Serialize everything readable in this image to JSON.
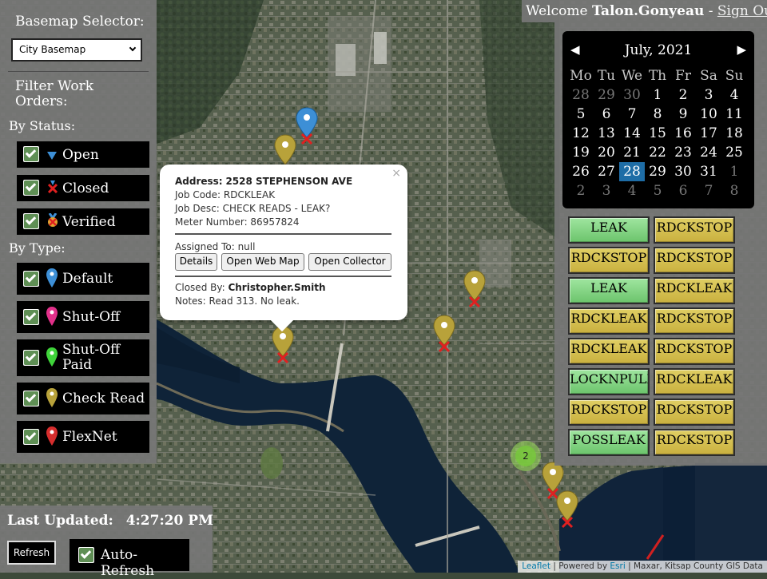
{
  "header": {
    "welcome_prefix": "Welcome",
    "username": "Talon.Gonyeau",
    "separator": "-",
    "signout_label": "Sign Out"
  },
  "left_panel": {
    "basemap_title": "Basemap Selector:",
    "basemap_selected": "City Basemap",
    "filter_title": "Filter Work Orders:",
    "by_status_label": "By Status:",
    "status_items": [
      {
        "label": "Open",
        "checked": true,
        "icon": "blue-triangle-icon"
      },
      {
        "label": "Closed",
        "checked": true,
        "icon": "red-x-icon"
      },
      {
        "label": "Verified",
        "checked": true,
        "icon": "verified-medal-icon"
      }
    ],
    "by_type_label": "By Type:",
    "type_items": [
      {
        "label": "Default",
        "checked": true,
        "icon": "blue-pin-icon",
        "color": "#3d8fd6"
      },
      {
        "label": "Shut-Off",
        "checked": true,
        "icon": "pink-pin-icon",
        "color": "#e2308a"
      },
      {
        "label": "Shut-Off",
        "label2": "Paid",
        "checked": true,
        "icon": "green-pin-icon",
        "color": "#3fd43a"
      },
      {
        "label": "Check Read",
        "checked": true,
        "icon": "gold-pin-icon",
        "color": "#b8a23a"
      },
      {
        "label": "FlexNet",
        "checked": true,
        "icon": "red-pin-icon",
        "color": "#d62d2d"
      }
    ]
  },
  "calendar": {
    "prev": "◀",
    "next": "▶",
    "title": "July, 2021",
    "weekdays": [
      "Mo",
      "Tu",
      "We",
      "Th",
      "Fr",
      "Sa",
      "Su"
    ],
    "weeks": [
      [
        "28",
        "29",
        "30",
        "1",
        "2",
        "3",
        "4"
      ],
      [
        "5",
        "6",
        "7",
        "8",
        "9",
        "10",
        "11"
      ],
      [
        "12",
        "13",
        "14",
        "15",
        "16",
        "17",
        "18"
      ],
      [
        "19",
        "20",
        "21",
        "22",
        "23",
        "24",
        "25"
      ],
      [
        "26",
        "27",
        "28",
        "29",
        "30",
        "31",
        "1"
      ],
      [
        "2",
        "3",
        "4",
        "5",
        "6",
        "7",
        "8"
      ]
    ],
    "selected_day": "28"
  },
  "work_orders": [
    {
      "label": "LEAK",
      "color": "green"
    },
    {
      "label": "RDCKSTOP",
      "color": "yellow"
    },
    {
      "label": "RDCKSTOP",
      "color": "yellow"
    },
    {
      "label": "RDCKSTOP",
      "color": "yellow"
    },
    {
      "label": "LEAK",
      "color": "green"
    },
    {
      "label": "RDCKLEAK",
      "color": "yellow"
    },
    {
      "label": "RDCKLEAK",
      "color": "yellow"
    },
    {
      "label": "RDCKSTOP",
      "color": "yellow"
    },
    {
      "label": "RDCKLEAK",
      "color": "yellow"
    },
    {
      "label": "RDCKSTOP",
      "color": "yellow"
    },
    {
      "label": "LOCKNPULL",
      "color": "green"
    },
    {
      "label": "RDCKLEAK",
      "color": "yellow"
    },
    {
      "label": "RDCKSTOP",
      "color": "yellow"
    },
    {
      "label": "RDCKSTOP",
      "color": "yellow"
    },
    {
      "label": "POSSLEAK",
      "color": "green"
    },
    {
      "label": "RDCKSTOP",
      "color": "yellow"
    }
  ],
  "popup": {
    "close": "×",
    "address_label": "Address:",
    "address": "2528 STEPHENSON AVE",
    "job_code": "Job Code: RDCKLEAK",
    "job_desc": "Job Desc: CHECK READS - LEAK?",
    "meter": "Meter Number: 86957824",
    "assigned": "Assigned To: null",
    "btn_details": "Details",
    "btn_webmap": "Open Web Map",
    "btn_collector": "Open Collector",
    "closed_by_label": "Closed By:",
    "closed_by": "Christopher.Smith",
    "notes": "Notes: Read 313. No leak."
  },
  "bottom_panel": {
    "last_updated_label": "Last Updated:",
    "last_updated_time": "4:27:20 PM",
    "refresh_label": "Refresh",
    "autorefresh_label": "Auto-Refresh",
    "autorefresh_checked": true
  },
  "cluster_count": "2",
  "attribution": {
    "leaflet": "Leaflet",
    "sep": "|",
    "powered": "Powered by",
    "esri": "Esri",
    "sources": "Maxar, Kitsap County GIS Data"
  },
  "colors": {
    "panel_bg": "#767676",
    "accent_blue": "#1e6da6",
    "open_marker": "#3d8fd6",
    "checkread_marker": "#b8a23a",
    "closed_x": "#e02020"
  }
}
